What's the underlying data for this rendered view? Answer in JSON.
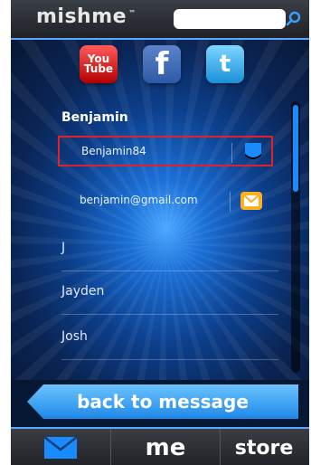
{
  "header": {
    "logo": "mishme",
    "logo_tm": "™",
    "search_placeholder": ""
  },
  "social": {
    "youtube_top": "You",
    "youtube_bottom": "Tube",
    "facebook": "f",
    "twitter": "t"
  },
  "contact": {
    "name": "Benjamin",
    "details": [
      {
        "text": "Benjamin84",
        "icon": "messenger-icon"
      },
      {
        "text": "benjamin@gmail.com",
        "icon": "email-icon"
      }
    ]
  },
  "contacts": [
    "J",
    "Jayden",
    "Josh"
  ],
  "back_button": {
    "label": "back to message"
  },
  "tabs": {
    "mail": "",
    "me": "me",
    "store": "store"
  },
  "colors": {
    "accent": "#1a8bff",
    "selection_border": "#e0202a",
    "email_icon": "#ffb020"
  }
}
